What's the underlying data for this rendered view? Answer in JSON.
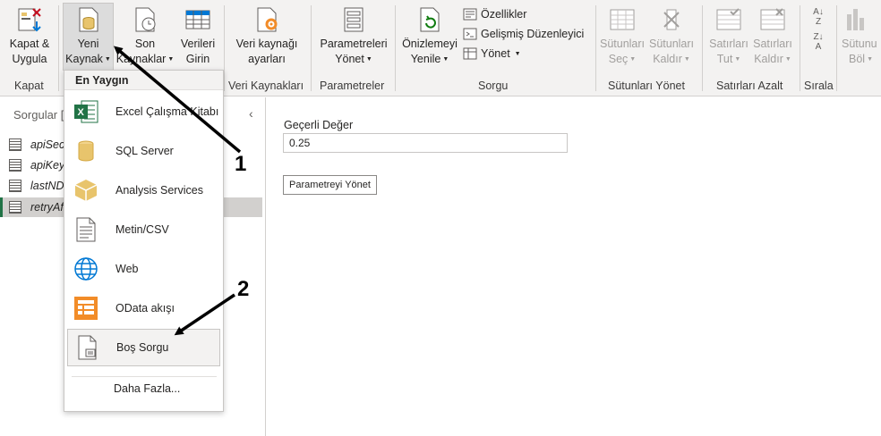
{
  "ribbon": {
    "close_apply": "Kapat &\nUygula",
    "new_source": {
      "line1": "Yeni",
      "line2": "Kaynak"
    },
    "recent_sources": {
      "line1": "Son",
      "line2": "Kaynaklar"
    },
    "enter_data": {
      "line1": "Verileri",
      "line2": "Girin"
    },
    "source_settings": {
      "line1": "Veri kaynağı",
      "line2": "ayarları"
    },
    "manage_params": {
      "line1": "Parametreleri",
      "line2": "Yönet"
    },
    "refresh_preview": {
      "line1": "Önizlemeyi",
      "line2": "Yenile"
    },
    "properties": "Özellikler",
    "advanced_editor": "Gelişmiş Düzenleyici",
    "manage": "Yönet",
    "choose_cols": {
      "line1": "Sütunları",
      "line2": "Seç"
    },
    "remove_cols": {
      "line1": "Sütunları",
      "line2": "Kaldır"
    },
    "keep_rows": {
      "line1": "Satırları",
      "line2": "Tut"
    },
    "remove_rows": {
      "line1": "Satırları",
      "line2": "Kaldır"
    },
    "split_col": {
      "line1": "Sütunu",
      "line2": "Böl"
    },
    "groups": {
      "close": "Kapat",
      "data_sources": "Veri Kaynakları",
      "parameters": "Parametreler",
      "query": "Sorgu",
      "manage_columns": "Sütunları Yönet",
      "reduce_rows": "Satırları Azalt",
      "sort": "Sırala"
    }
  },
  "queries": {
    "title": "Sorgular [",
    "items": [
      "apiSecr",
      "apiKey",
      "lastND",
      "retryAf"
    ]
  },
  "main": {
    "current_value_label": "Geçerli Değer",
    "current_value": "0.25",
    "manage_param_button": "Parametreyi Yönet"
  },
  "dropdown": {
    "header": "En Yaygın",
    "items": [
      "Excel Çalışma Kitabı",
      "SQL Server",
      "Analysis Services",
      "Metin/CSV",
      "Web",
      "OData akışı",
      "Boş Sorgu"
    ],
    "more": "Daha Fazla..."
  },
  "annotations": {
    "one": "1",
    "two": "2"
  },
  "colors": {
    "excel_green": "#217346",
    "odata_orange": "#f28c28",
    "db_yellow": "#e8c46c",
    "ribbon_bg": "#f3f2f1"
  }
}
